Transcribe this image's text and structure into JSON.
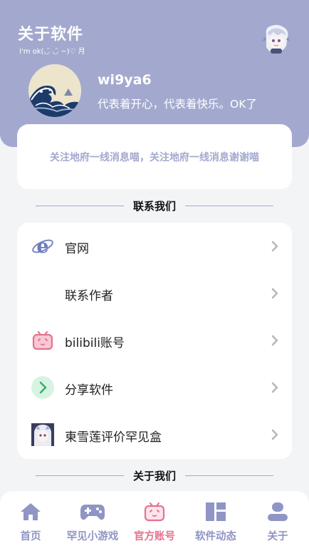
{
  "header": {
    "title": "关于软件",
    "subtitle": "I'm ok(◡̈ ◡̈ ~)♡ 月",
    "username": "wi9ya6",
    "bio": "代表着开心，代表着快乐。OK了"
  },
  "notice": {
    "text": "关注地府一线消息喵，关注地府一线消息谢谢喵"
  },
  "sections": {
    "contact": "联系我们",
    "about": "关于我们"
  },
  "links": [
    {
      "label": "官网",
      "icon": "ie-icon"
    },
    {
      "label": "联系作者",
      "icon": ""
    },
    {
      "label": "bilibili账号",
      "icon": "bilibili-icon"
    },
    {
      "label": "分享软件",
      "icon": "share-icon"
    },
    {
      "label": "東雪莲评价罕见盒",
      "icon": "character-avatar-icon"
    }
  ],
  "tabs": [
    {
      "label": "首页",
      "icon": "home-icon"
    },
    {
      "label": "罕见小游戏",
      "icon": "gamepad-icon"
    },
    {
      "label": "官方账号",
      "icon": "bilibili-tv-icon"
    },
    {
      "label": "软件动态",
      "icon": "dashboard-icon"
    },
    {
      "label": "关于",
      "icon": "user-icon"
    }
  ],
  "active_tab": "官方账号",
  "colors": {
    "accent": "#a3a9ce",
    "active": "#e5738f",
    "share_green": "#34b36b"
  }
}
